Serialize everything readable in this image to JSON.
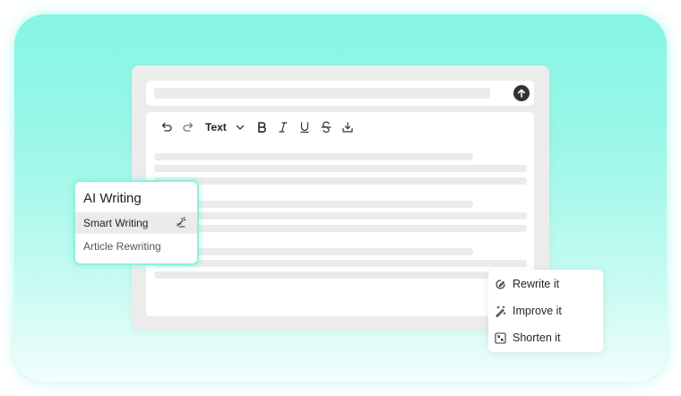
{
  "toolbar": {
    "style_label": "Text",
    "icons": [
      "undo-icon",
      "redo-icon",
      "chevron-down-icon",
      "bold-icon",
      "italic-icon",
      "underline-icon",
      "strikethrough-icon",
      "download-icon"
    ]
  },
  "topbar": {
    "icon": "arrow-up-icon"
  },
  "ai_panel": {
    "title": "AI Writing",
    "items": [
      {
        "label": "Smart Writing",
        "icon": "wand-icon",
        "active": true
      },
      {
        "label": "Article Rewriting",
        "active": false
      }
    ]
  },
  "context_menu": {
    "items": [
      {
        "label": "Rewrite it",
        "icon": "rewrite-icon"
      },
      {
        "label": "Improve it",
        "icon": "magic-wand-icon"
      },
      {
        "label": "Shorten it",
        "icon": "shorten-icon"
      }
    ]
  },
  "colors": {
    "accent": "#8cf1dd",
    "background_top": "#86f5e3",
    "background_bottom": "#f2fefc"
  }
}
